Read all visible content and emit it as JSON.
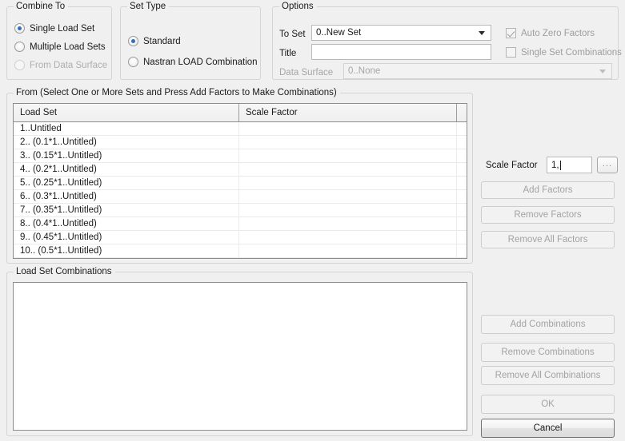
{
  "combine_to": {
    "legend": "Combine To",
    "options": [
      {
        "label": "Single Load Set",
        "selected": true,
        "disabled": false
      },
      {
        "label": "Multiple Load Sets",
        "selected": false,
        "disabled": false
      },
      {
        "label": "From Data Surface",
        "selected": false,
        "disabled": true
      }
    ]
  },
  "set_type": {
    "legend": "Set Type",
    "options": [
      {
        "label": "Standard",
        "selected": true,
        "disabled": false
      },
      {
        "label": "Nastran LOAD Combination",
        "selected": false,
        "disabled": false
      }
    ]
  },
  "options": {
    "legend": "Options",
    "to_set_label": "To Set",
    "to_set_value": "0..New Set",
    "title_label": "Title",
    "title_value": "",
    "title_placeholder": "",
    "data_surface_label": "Data Surface",
    "data_surface_value": "0..None",
    "auto_zero_factors_label": "Auto Zero Factors",
    "single_set_combinations_label": "Single Set Combinations"
  },
  "from_group": {
    "legend": "From   (Select One or More Sets and Press Add Factors to Make Combinations)",
    "columns": [
      "Load Set",
      "Scale Factor",
      ""
    ],
    "rows": [
      {
        "load_set": "1..Untitled",
        "scale_factor": ""
      },
      {
        "load_set": "2.. (0.1*1..Untitled)",
        "scale_factor": ""
      },
      {
        "load_set": "3.. (0.15*1..Untitled)",
        "scale_factor": ""
      },
      {
        "load_set": "4.. (0.2*1..Untitled)",
        "scale_factor": ""
      },
      {
        "load_set": "5.. (0.25*1..Untitled)",
        "scale_factor": ""
      },
      {
        "load_set": "6.. (0.3*1..Untitled)",
        "scale_factor": ""
      },
      {
        "load_set": "7.. (0.35*1..Untitled)",
        "scale_factor": ""
      },
      {
        "load_set": "8.. (0.4*1..Untitled)",
        "scale_factor": ""
      },
      {
        "load_set": "9.. (0.45*1..Untitled)",
        "scale_factor": ""
      },
      {
        "load_set": "10.. (0.5*1..Untitled)",
        "scale_factor": ""
      }
    ]
  },
  "combinations_group": {
    "legend": "Load Set Combinations",
    "items": []
  },
  "side_panel": {
    "scale_factor_label": "Scale Factor",
    "scale_factor_value": "1,",
    "browse_label": "...",
    "add_factors": "Add Factors",
    "remove_factors": "Remove Factors",
    "remove_all_factors": "Remove All Factors",
    "add_combinations": "Add Combinations",
    "remove_combinations": "Remove Combinations",
    "remove_all_combinations": "Remove All Combinations",
    "ok": "OK",
    "cancel": "Cancel"
  },
  "colors": {
    "window_bg": "#f0f0f0",
    "accent": "#2f6fb5",
    "border": "#8d8d8d",
    "disabled_text": "#a3a3a3"
  }
}
